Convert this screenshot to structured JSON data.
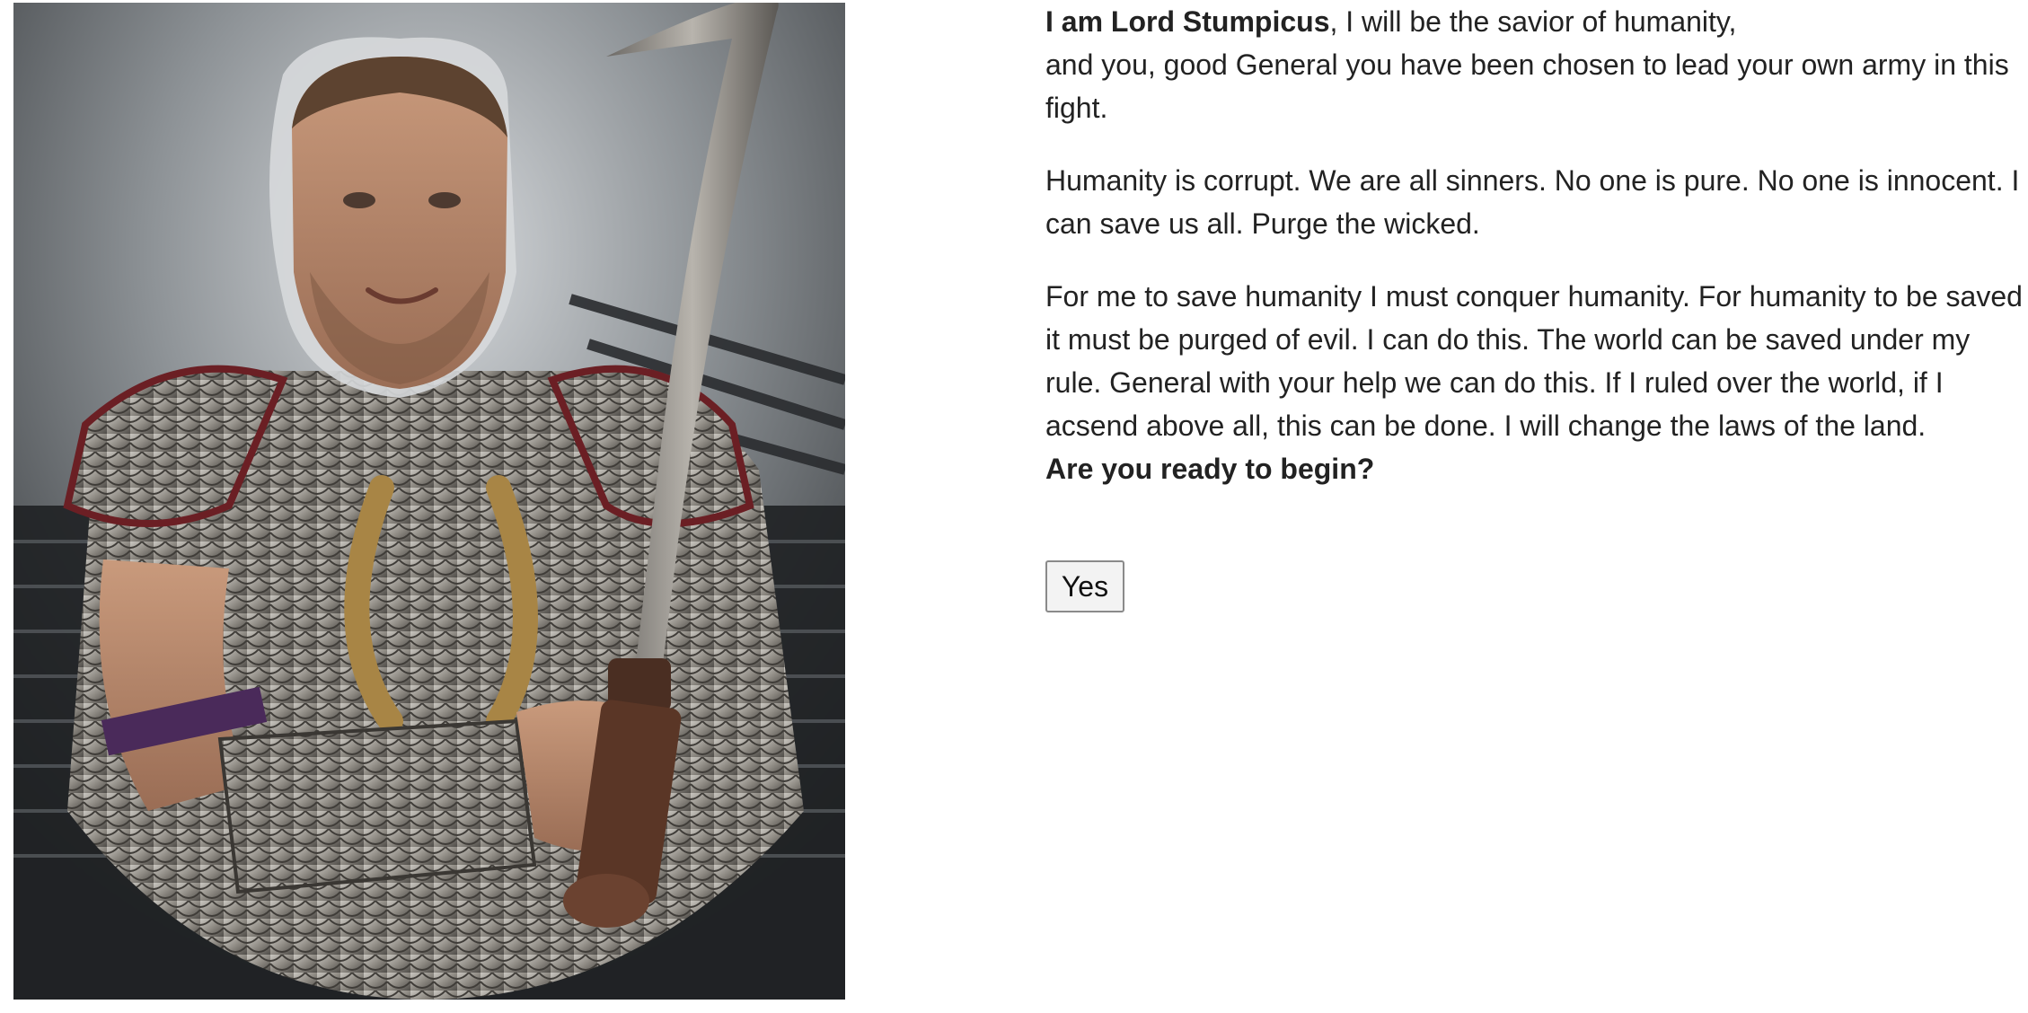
{
  "portrait": {
    "alt": "Lord Stumpicus in armor holding a sword"
  },
  "intro": {
    "name_bold": "I am Lord Stumpicus",
    "line1_rest": ", I will be the savior of humanity,",
    "line2": "and you, good General you have been chosen to lead your own army in this fight."
  },
  "paragraphs": [
    "Humanity is corrupt. We are all sinners. No one is pure. No one is innocent. I can save us all. Purge the wicked.",
    "For me to save humanity I must conquer humanity. For humanity to be saved it must be purged of evil. I can do this. The world can be saved under my rule. General with your help we can do this. If I ruled over the world, if I acsend above all, this can be done. I will change the laws of the land."
  ],
  "question": "Are you ready to begin?",
  "yes_button": "Yes"
}
